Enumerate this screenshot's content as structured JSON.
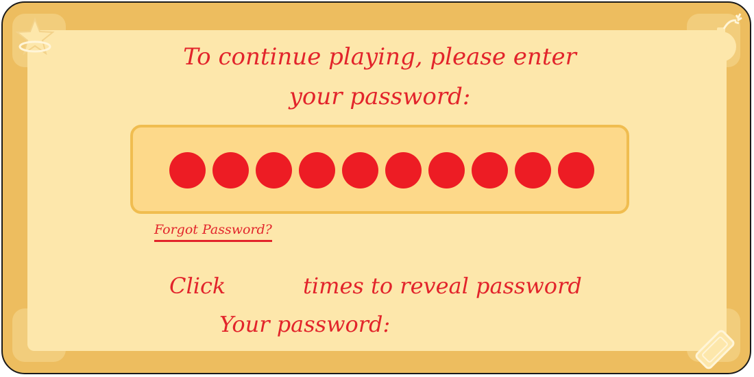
{
  "window": {
    "title": "To continue playing, please enter\nyour password:"
  },
  "password": {
    "masked_char_count": 10,
    "mask_color": "#ed1c24"
  },
  "links": {
    "forgot_password": "Forgot Password?"
  },
  "reveal": {
    "click_label": "Click",
    "click_count": "",
    "times_label": "times to reveal password",
    "your_password_label": "Your password:",
    "revealed_value": ""
  },
  "icons": {
    "top_left": "star-icon",
    "top_right": "bomb-icon",
    "bottom_right": "candy-bar-icon"
  },
  "colors": {
    "frame": "#edbd5f",
    "panel": "#fde7ab",
    "field": "#fdd98a",
    "text": "#e2242b"
  }
}
